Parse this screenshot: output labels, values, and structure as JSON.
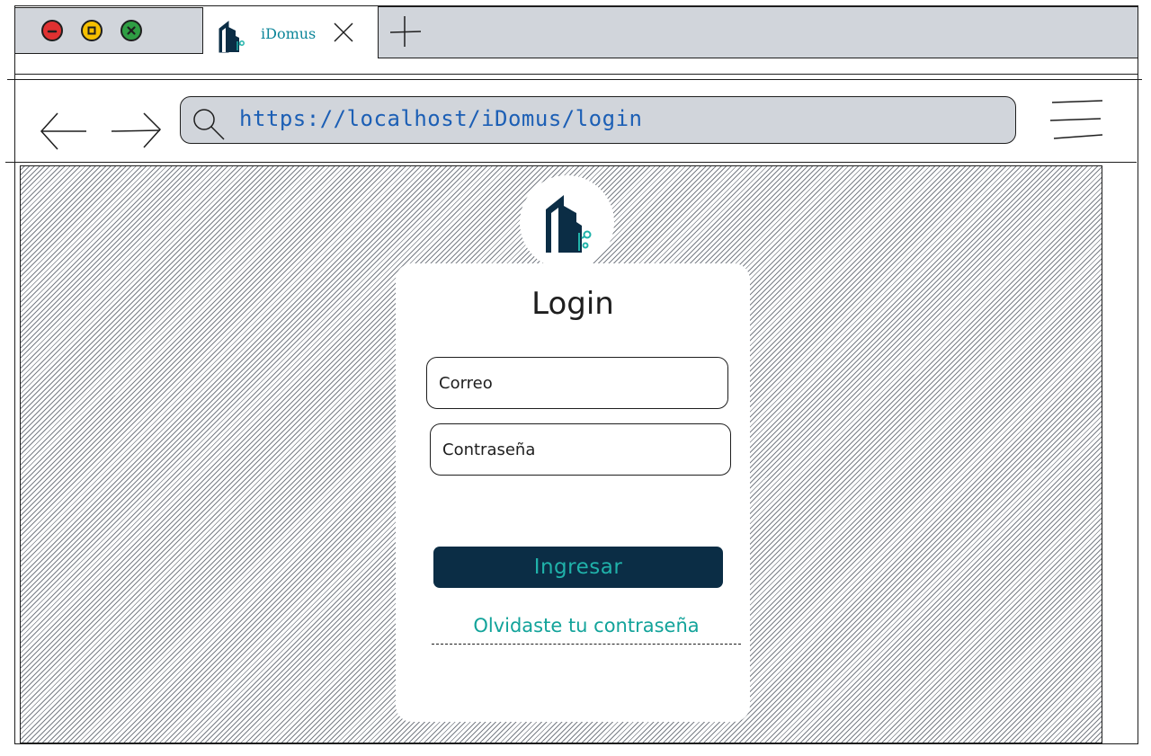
{
  "window": {
    "controls": [
      "close-icon",
      "maximize-icon",
      "fullscreen-icon"
    ],
    "colors": {
      "close": "#e03131",
      "maximize": "#f6c000",
      "fullscreen": "#2f9e44"
    }
  },
  "tab": {
    "title": "iDomus",
    "icon": "building-logo-icon",
    "close_icon": "close-icon",
    "new_tab_icon": "plus-icon"
  },
  "toolbar": {
    "back_icon": "arrow-left-icon",
    "forward_icon": "arrow-right-icon",
    "search_icon": "search-icon",
    "url": "https://localhost/iDomus/login",
    "menu_icon": "hamburger-menu-icon"
  },
  "login": {
    "logo_icon": "building-logo-icon",
    "title": "Login",
    "email_placeholder": "Correo",
    "password_placeholder": "Contraseña",
    "submit_label": "Ingresar",
    "forgot_label": "Olvidaste tu contraseña"
  },
  "colors": {
    "brand_dark": "#0b2d45",
    "brand_teal": "#20b2aa",
    "link": "#12a39a",
    "url_text": "#1c5fb5",
    "chrome_gray": "#d1d5db"
  }
}
